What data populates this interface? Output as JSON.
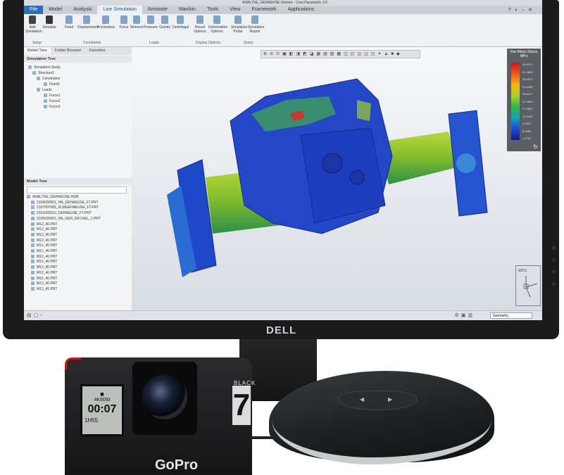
{
  "app": {
    "title": "ANALYSE_GEHAEUSE (Active) - Creo Parametric 3.0",
    "tabs": [
      "File",
      "Model",
      "Analysis",
      "Live Simulation",
      "Annotate",
      "Manikin",
      "Tools",
      "View",
      "Framework",
      "Applications"
    ],
    "active_tab": "Live Simulation"
  },
  "ribbon": {
    "buttons": [
      "Add Simulation",
      "Simulate",
      "Fixed",
      "Displacement",
      "Frictionless",
      "Force",
      "Moment",
      "Pressure",
      "Gravity",
      "Centrifugal",
      "Result Options",
      "Deformation Options",
      "Simulation Probe",
      "Simulation Report"
    ],
    "groups": [
      "Setup",
      "Constraints",
      "Loads",
      "Display Options",
      "Query"
    ]
  },
  "sim_panel": {
    "tabs": [
      "Model Tree",
      "Folder Browser",
      "Favorites"
    ],
    "header": "Simulation Tree",
    "nodes": [
      "Simulation Study",
      "Structure1",
      "Constraints",
      "Fixed1",
      "Loads",
      "Force1",
      "Force2",
      "Force3"
    ]
  },
  "model_tree": {
    "header": "Model Tree",
    "items": [
      "ANALYSE_GEHAEUSE.ASM",
      "2105030001_HA_GEHAEUSE_FT.PRT",
      "2107007005_KLMGEHAEUSE_FT.PRT",
      "2101003010_GEHAEUSE_FT.PRT",
      "2105030001_HA_GEH_DECKEL_1.PRT",
      "M12_40.PRT",
      "M12_40.PRT",
      "M12_40.PRT",
      "M12_40.PRT",
      "M12_40.PRT",
      "M12_40.PRT",
      "M12_40.PRT",
      "M12_40.PRT",
      "M12_40.PRT",
      "M12_40.PRT",
      "M12_40.PRT",
      "M12_40.PRT",
      "M12_45.PRT"
    ]
  },
  "legend": {
    "title": "Von Mises Stress",
    "unit": "MPa",
    "ticks": [
      "41.9971",
      "37.4800",
      "33.4572",
      "29.4345",
      "25.4117",
      "21.3890",
      "17.3662",
      "13.3435",
      "9.3207",
      "5.2980",
      "1.2752"
    ]
  },
  "status": {
    "filter": "Geometry"
  },
  "colors": {
    "high_stress": "#c7171d",
    "mid_stress": "#a8d12a",
    "low_stress": "#1c48d6",
    "monitor_bezel": "#1b1b1b"
  },
  "hardware": {
    "monitor_brand": "DELL",
    "camera_brand": "GoPro",
    "camera_model": "7",
    "camera_edition": "BLACK",
    "camera_lcd": {
      "mode": "4K60W",
      "counter": "00:07",
      "remaining": "1H55"
    }
  }
}
